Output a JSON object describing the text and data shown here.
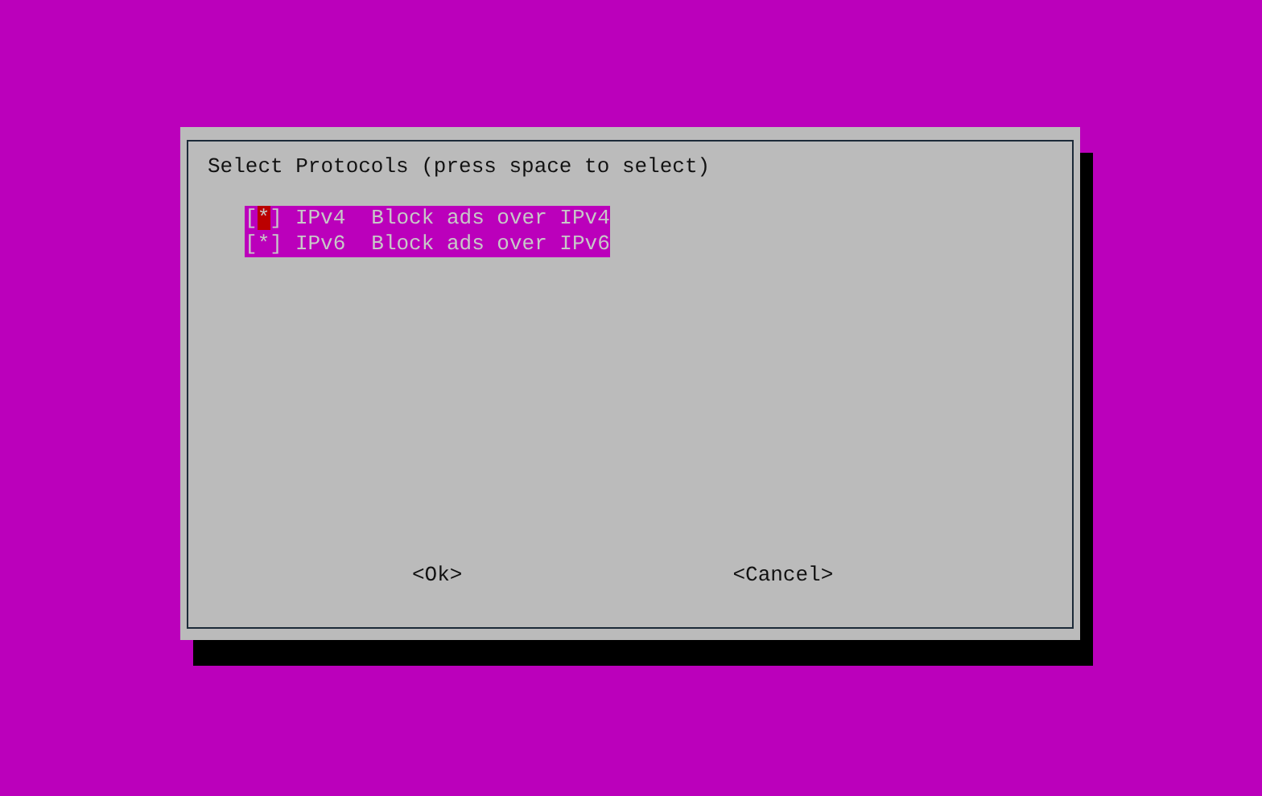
{
  "dialog": {
    "prompt": "Select Protocols (press space to select)",
    "items": [
      {
        "bracket_left": "[",
        "mark": "*",
        "bracket_right": "]",
        "tag": "IPv4",
        "description": "Block ads over IPv4",
        "checked": true,
        "focused": true,
        "highlighted": true
      },
      {
        "bracket_left": "[",
        "mark": "*",
        "bracket_right": "]",
        "tag": "IPv6",
        "description": "Block ads over IPv6",
        "checked": true,
        "focused": false,
        "highlighted": true
      }
    ],
    "buttons": [
      {
        "label": "<Ok>"
      },
      {
        "label": "<Cancel>"
      }
    ]
  }
}
